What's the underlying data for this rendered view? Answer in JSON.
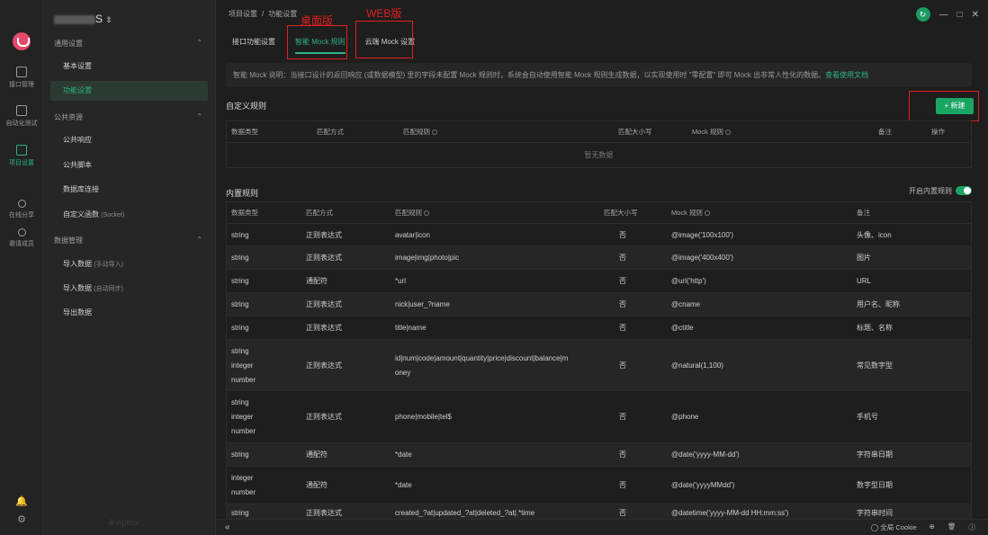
{
  "rail": {
    "items": [
      {
        "label": "接口管理"
      },
      {
        "label": "自动化测试"
      },
      {
        "label": "项目设置"
      },
      {
        "label": "在线分享"
      },
      {
        "label": "邀请成员"
      }
    ],
    "bottom": [
      "bell-icon",
      "gear-icon"
    ]
  },
  "sidebar": {
    "project_suffix": "S",
    "groups": [
      {
        "title": "通用设置",
        "items": [
          {
            "label": "基本设置"
          },
          {
            "label": "功能设置"
          }
        ]
      },
      {
        "title": "公共资源",
        "items": [
          {
            "label": "公共响应"
          },
          {
            "label": "公共脚本"
          },
          {
            "label": "数据库连接"
          },
          {
            "label": "自定义函数",
            "sub": "(Socket)"
          }
        ]
      },
      {
        "title": "数据管理",
        "items": [
          {
            "label": "导入数据",
            "sub": "(手动导入)"
          },
          {
            "label": "导入数据",
            "sub": "(自动同步)"
          },
          {
            "label": "导出数据"
          }
        ]
      }
    ],
    "watermark": "Apifox"
  },
  "breadcrumb": {
    "parent": "项目设置",
    "sep": "/",
    "current": "功能设置"
  },
  "tabs": [
    {
      "label": "接口功能设置"
    },
    {
      "label": "智能 Mock 规则"
    },
    {
      "label": "云端 Mock 设置"
    }
  ],
  "annotations": {
    "desktop": "桌面版",
    "web": "WEB版"
  },
  "notice": {
    "text": "智能 Mock 说明：当接口设计的返回响应 (或数据模型) 里的字段未配置 Mock 规则时，系统会自动使用智能 Mock 规则生成数据，以实现使用时 \"零配置\" 即可 Mock 出非常人性化的数据。",
    "link": "查看使用文档"
  },
  "custom": {
    "title": "自定义规则",
    "new_button": "新建",
    "headers": [
      "数据类型",
      "匹配方式",
      "匹配规则",
      "匹配大小写",
      "Mock 规则",
      "备注",
      "操作"
    ],
    "empty": "暂无数据"
  },
  "builtin": {
    "title": "内置规则",
    "switch_label": "开启内置规则",
    "headers": [
      "数据类型",
      "匹配方式",
      "匹配规则",
      "匹配大小写",
      "Mock 规则",
      "备注"
    ],
    "rows": [
      {
        "type": "string",
        "method": "正则表达式",
        "rule": "avatar|icon",
        "case": "否",
        "mock": "@image('100x100')",
        "note": "头像、icon"
      },
      {
        "type": "string",
        "method": "正则表达式",
        "rule": "image|img|photo|pic",
        "case": "否",
        "mock": "@image('400x400')",
        "note": "图片"
      },
      {
        "type": "string",
        "method": "通配符",
        "rule": "*url",
        "case": "否",
        "mock": "@url('http')",
        "note": "URL"
      },
      {
        "type": "string",
        "method": "正则表达式",
        "rule": "nick|user_?name",
        "case": "否",
        "mock": "@cname",
        "note": "用户名、昵称"
      },
      {
        "type": "string",
        "method": "正则表达式",
        "rule": "title|name",
        "case": "否",
        "mock": "@ctitle",
        "note": "标题、名称"
      },
      {
        "type": "string\ninteger\nnumber",
        "method": "正则表达式",
        "rule": "id|num|code|amount|quantity|price|discount|balance|m\noney",
        "case": "否",
        "mock": "@natural(1,100)",
        "note": "常见数字型"
      },
      {
        "type": "string\ninteger\nnumber",
        "method": "正则表达式",
        "rule": "phone|mobile|tel$",
        "case": "否",
        "mock": "@phone",
        "note": "手机号"
      },
      {
        "type": "string",
        "method": "通配符",
        "rule": "*date",
        "case": "否",
        "mock": "@date('yyyy-MM-dd')",
        "note": "字符串日期"
      },
      {
        "type": "integer\nnumber",
        "method": "通配符",
        "rule": "*date",
        "case": "否",
        "mock": "@date('yyyyMMdd')",
        "note": "数字型日期"
      },
      {
        "type": "string",
        "method": "正则表达式",
        "rule": "created_?at|updated_?at|deleted_?at|.*time",
        "case": "否",
        "mock": "@datetime('yyyy-MM-dd HH:mm:ss')",
        "note": "字符串时间"
      }
    ]
  },
  "statusbar": {
    "cookie": "全局 Cookie"
  }
}
